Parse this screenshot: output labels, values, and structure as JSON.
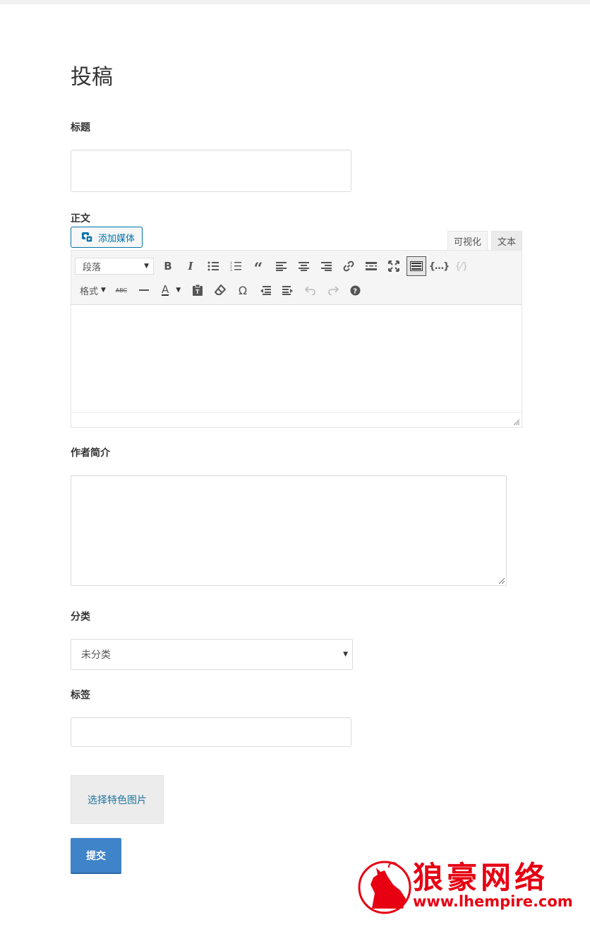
{
  "page": {
    "title": "投稿"
  },
  "fields": {
    "title_label": "标题",
    "title_value": "",
    "content_label": "正文",
    "bio_label": "作者简介",
    "category_label": "分类",
    "category_selected": "未分类",
    "tags_label": "标签",
    "tags_value": ""
  },
  "editor": {
    "add_media_label": "添加媒体",
    "tabs": {
      "visual": "可视化",
      "text": "文本"
    },
    "paragraph_select": "段落",
    "format_menu": "格式",
    "toolbar_row1_icons": [
      "bold-icon",
      "italic-icon",
      "bulleted-list-icon",
      "numbered-list-icon",
      "blockquote-icon",
      "align-left-icon",
      "align-center-icon",
      "align-right-icon",
      "link-icon",
      "read-more-icon",
      "fullscreen-icon",
      "toolbar-toggle-icon",
      "code-icon",
      "unlink-icon"
    ],
    "toolbar_row2_icons": [
      "strikethrough-icon",
      "horizontal-line-icon",
      "text-color-icon",
      "paste-text-icon",
      "clear-formatting-icon",
      "special-character-icon",
      "outdent-icon",
      "indent-icon",
      "undo-icon",
      "redo-icon",
      "help-icon"
    ]
  },
  "featured_image": {
    "label": "选择特色图片"
  },
  "submit": {
    "label": "提交"
  },
  "watermark": {
    "title": "狼豪网络",
    "url": "www.lhempire.com"
  },
  "colors": {
    "primary": "#3f83c9",
    "link": "#0073aa",
    "watermark": "#e60012"
  }
}
